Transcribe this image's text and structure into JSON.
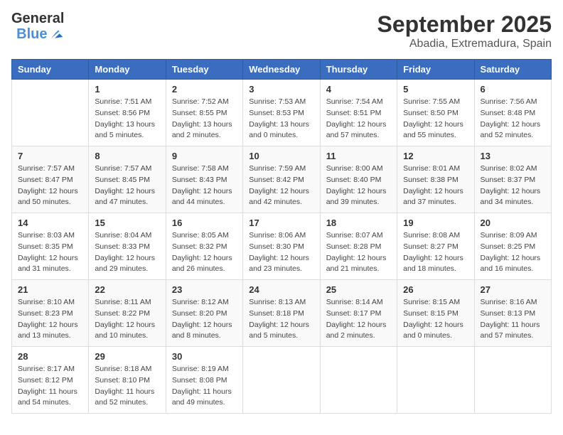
{
  "logo": {
    "general": "General",
    "blue": "Blue"
  },
  "title": "September 2025",
  "location": "Abadia, Extremadura, Spain",
  "weekdays": [
    "Sunday",
    "Monday",
    "Tuesday",
    "Wednesday",
    "Thursday",
    "Friday",
    "Saturday"
  ],
  "weeks": [
    [
      {
        "day": null
      },
      {
        "day": "1",
        "sunrise": "Sunrise: 7:51 AM",
        "sunset": "Sunset: 8:56 PM",
        "daylight": "Daylight: 13 hours and 5 minutes."
      },
      {
        "day": "2",
        "sunrise": "Sunrise: 7:52 AM",
        "sunset": "Sunset: 8:55 PM",
        "daylight": "Daylight: 13 hours and 2 minutes."
      },
      {
        "day": "3",
        "sunrise": "Sunrise: 7:53 AM",
        "sunset": "Sunset: 8:53 PM",
        "daylight": "Daylight: 13 hours and 0 minutes."
      },
      {
        "day": "4",
        "sunrise": "Sunrise: 7:54 AM",
        "sunset": "Sunset: 8:51 PM",
        "daylight": "Daylight: 12 hours and 57 minutes."
      },
      {
        "day": "5",
        "sunrise": "Sunrise: 7:55 AM",
        "sunset": "Sunset: 8:50 PM",
        "daylight": "Daylight: 12 hours and 55 minutes."
      },
      {
        "day": "6",
        "sunrise": "Sunrise: 7:56 AM",
        "sunset": "Sunset: 8:48 PM",
        "daylight": "Daylight: 12 hours and 52 minutes."
      }
    ],
    [
      {
        "day": "7",
        "sunrise": "Sunrise: 7:57 AM",
        "sunset": "Sunset: 8:47 PM",
        "daylight": "Daylight: 12 hours and 50 minutes."
      },
      {
        "day": "8",
        "sunrise": "Sunrise: 7:57 AM",
        "sunset": "Sunset: 8:45 PM",
        "daylight": "Daylight: 12 hours and 47 minutes."
      },
      {
        "day": "9",
        "sunrise": "Sunrise: 7:58 AM",
        "sunset": "Sunset: 8:43 PM",
        "daylight": "Daylight: 12 hours and 44 minutes."
      },
      {
        "day": "10",
        "sunrise": "Sunrise: 7:59 AM",
        "sunset": "Sunset: 8:42 PM",
        "daylight": "Daylight: 12 hours and 42 minutes."
      },
      {
        "day": "11",
        "sunrise": "Sunrise: 8:00 AM",
        "sunset": "Sunset: 8:40 PM",
        "daylight": "Daylight: 12 hours and 39 minutes."
      },
      {
        "day": "12",
        "sunrise": "Sunrise: 8:01 AM",
        "sunset": "Sunset: 8:38 PM",
        "daylight": "Daylight: 12 hours and 37 minutes."
      },
      {
        "day": "13",
        "sunrise": "Sunrise: 8:02 AM",
        "sunset": "Sunset: 8:37 PM",
        "daylight": "Daylight: 12 hours and 34 minutes."
      }
    ],
    [
      {
        "day": "14",
        "sunrise": "Sunrise: 8:03 AM",
        "sunset": "Sunset: 8:35 PM",
        "daylight": "Daylight: 12 hours and 31 minutes."
      },
      {
        "day": "15",
        "sunrise": "Sunrise: 8:04 AM",
        "sunset": "Sunset: 8:33 PM",
        "daylight": "Daylight: 12 hours and 29 minutes."
      },
      {
        "day": "16",
        "sunrise": "Sunrise: 8:05 AM",
        "sunset": "Sunset: 8:32 PM",
        "daylight": "Daylight: 12 hours and 26 minutes."
      },
      {
        "day": "17",
        "sunrise": "Sunrise: 8:06 AM",
        "sunset": "Sunset: 8:30 PM",
        "daylight": "Daylight: 12 hours and 23 minutes."
      },
      {
        "day": "18",
        "sunrise": "Sunrise: 8:07 AM",
        "sunset": "Sunset: 8:28 PM",
        "daylight": "Daylight: 12 hours and 21 minutes."
      },
      {
        "day": "19",
        "sunrise": "Sunrise: 8:08 AM",
        "sunset": "Sunset: 8:27 PM",
        "daylight": "Daylight: 12 hours and 18 minutes."
      },
      {
        "day": "20",
        "sunrise": "Sunrise: 8:09 AM",
        "sunset": "Sunset: 8:25 PM",
        "daylight": "Daylight: 12 hours and 16 minutes."
      }
    ],
    [
      {
        "day": "21",
        "sunrise": "Sunrise: 8:10 AM",
        "sunset": "Sunset: 8:23 PM",
        "daylight": "Daylight: 12 hours and 13 minutes."
      },
      {
        "day": "22",
        "sunrise": "Sunrise: 8:11 AM",
        "sunset": "Sunset: 8:22 PM",
        "daylight": "Daylight: 12 hours and 10 minutes."
      },
      {
        "day": "23",
        "sunrise": "Sunrise: 8:12 AM",
        "sunset": "Sunset: 8:20 PM",
        "daylight": "Daylight: 12 hours and 8 minutes."
      },
      {
        "day": "24",
        "sunrise": "Sunrise: 8:13 AM",
        "sunset": "Sunset: 8:18 PM",
        "daylight": "Daylight: 12 hours and 5 minutes."
      },
      {
        "day": "25",
        "sunrise": "Sunrise: 8:14 AM",
        "sunset": "Sunset: 8:17 PM",
        "daylight": "Daylight: 12 hours and 2 minutes."
      },
      {
        "day": "26",
        "sunrise": "Sunrise: 8:15 AM",
        "sunset": "Sunset: 8:15 PM",
        "daylight": "Daylight: 12 hours and 0 minutes."
      },
      {
        "day": "27",
        "sunrise": "Sunrise: 8:16 AM",
        "sunset": "Sunset: 8:13 PM",
        "daylight": "Daylight: 11 hours and 57 minutes."
      }
    ],
    [
      {
        "day": "28",
        "sunrise": "Sunrise: 8:17 AM",
        "sunset": "Sunset: 8:12 PM",
        "daylight": "Daylight: 11 hours and 54 minutes."
      },
      {
        "day": "29",
        "sunrise": "Sunrise: 8:18 AM",
        "sunset": "Sunset: 8:10 PM",
        "daylight": "Daylight: 11 hours and 52 minutes."
      },
      {
        "day": "30",
        "sunrise": "Sunrise: 8:19 AM",
        "sunset": "Sunset: 8:08 PM",
        "daylight": "Daylight: 11 hours and 49 minutes."
      },
      {
        "day": null
      },
      {
        "day": null
      },
      {
        "day": null
      },
      {
        "day": null
      }
    ]
  ]
}
